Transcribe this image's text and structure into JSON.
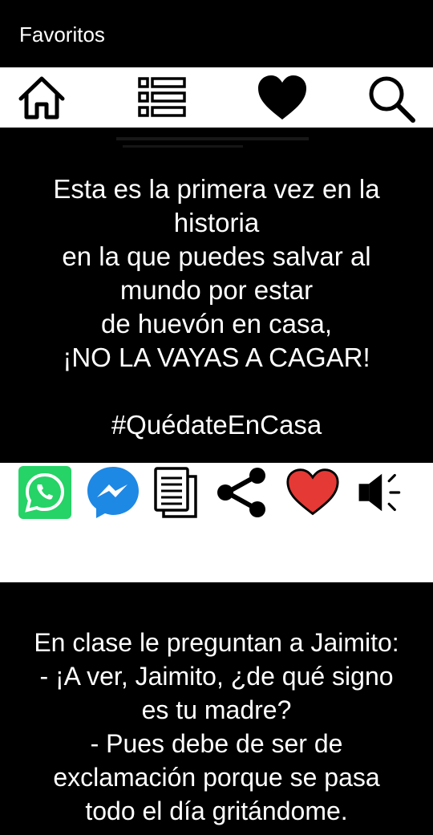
{
  "appbar": {
    "title": "Favoritos"
  },
  "tabs": [
    {
      "icon": "home-icon"
    },
    {
      "icon": "list-icon"
    },
    {
      "icon": "heart-icon"
    },
    {
      "icon": "search-icon"
    }
  ],
  "posts": [
    {
      "lines": [
        "Esta es la primera vez en la",
        "historia",
        "en la que puedes salvar al",
        "mundo por estar",
        "de huevón en casa,",
        "¡NO LA VAYAS A CAGAR!",
        "",
        "#QuédateEnCasa"
      ]
    },
    {
      "lines": [
        "En clase le preguntan a Jaimito:",
        "- ¡A ver, Jaimito, ¿de qué signo",
        "es tu madre?",
        "- Pues debe de ser de",
        "exclamación porque se pasa",
        "todo el día gritándome."
      ]
    }
  ],
  "actions": [
    {
      "icon": "whatsapp-icon",
      "color": "#25D366"
    },
    {
      "icon": "messenger-icon",
      "color": "#1E88E5"
    },
    {
      "icon": "copy-icon",
      "color": "#000000"
    },
    {
      "icon": "share-icon",
      "color": "#000000"
    },
    {
      "icon": "heart-red-icon",
      "color": "#E53935"
    },
    {
      "icon": "speaker-icon",
      "color": "#000000"
    }
  ]
}
